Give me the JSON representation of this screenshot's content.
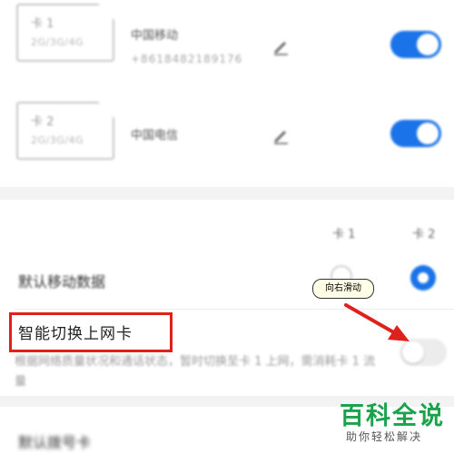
{
  "sims": [
    {
      "slot_label": "卡 1",
      "bands": "2G/3G/4G",
      "carrier": "中国移动",
      "phone": "+8618482189176",
      "enabled": true
    },
    {
      "slot_label": "卡 2",
      "bands": "2G/3G/4G",
      "carrier": "中国电信",
      "phone": "",
      "enabled": true
    }
  ],
  "columns": {
    "card1": "卡 1",
    "card2": "卡 2"
  },
  "default_data": {
    "label": "默认移动数据",
    "selected": "card2"
  },
  "smart_switch": {
    "label": "智能切换上网卡",
    "description": "根据网络质量状况和通话状态，暂时切换至卡 1 上网，需消耗卡 1 流量",
    "enabled": false
  },
  "default_dial": {
    "label": "默认拨号卡"
  },
  "annotation": {
    "callout_text": "向右滑动"
  },
  "watermark": {
    "title": "百科全说",
    "subtitle": "助你轻松解决"
  },
  "colors": {
    "accent": "#1a73e8",
    "highlight": "#e0201a",
    "watermark": "#1aa34a"
  }
}
